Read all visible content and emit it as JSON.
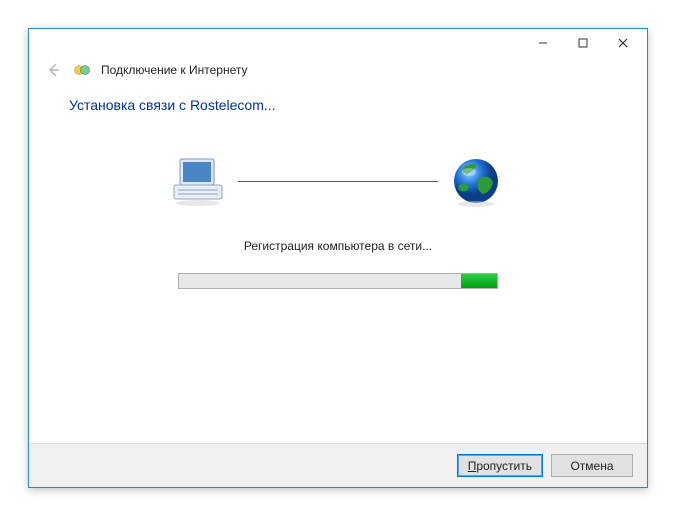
{
  "titlebar": {
    "minimize": "minimize",
    "maximize": "maximize",
    "close": "close"
  },
  "header": {
    "title": "Подключение к Интернету"
  },
  "content": {
    "main_title": "Установка связи с Rostelecom...",
    "status_text": "Регистрация компьютера в сети..."
  },
  "buttons": {
    "skip_prefix": "П",
    "skip_rest": "ропустить",
    "cancel": "Отмена"
  }
}
